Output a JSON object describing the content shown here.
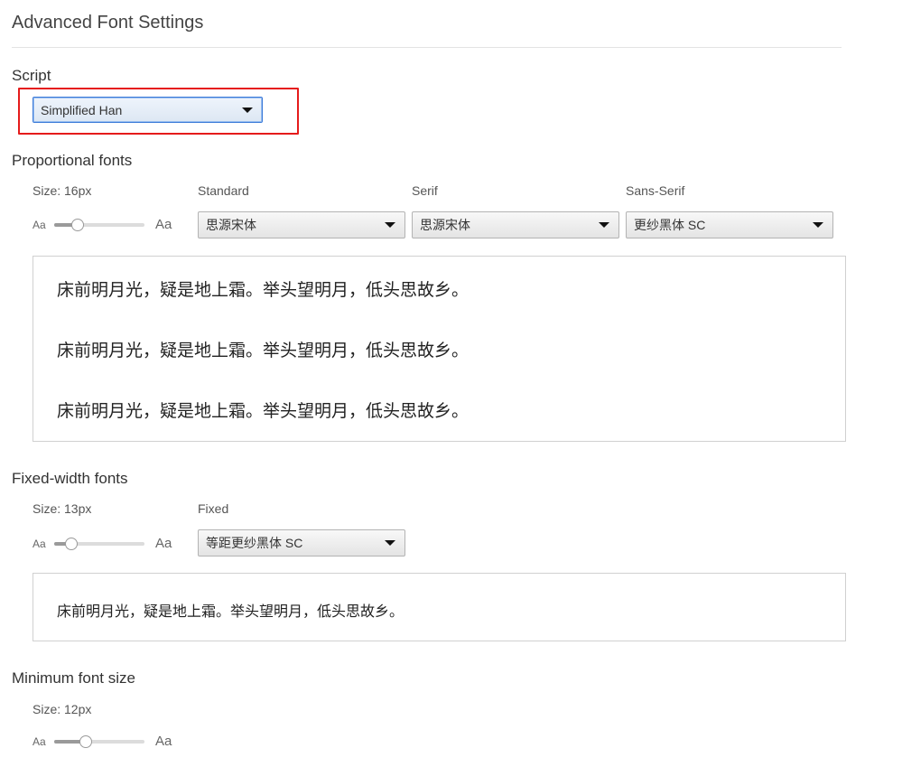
{
  "page": {
    "title": "Advanced Font Settings"
  },
  "script_section": {
    "label": "Script",
    "selected": "Simplified Han"
  },
  "proportional": {
    "heading": "Proportional fonts",
    "size_label": "Size: 16px",
    "slider": {
      "min_label": "Aa",
      "max_label": "Aa",
      "level": 0.26
    },
    "standard": {
      "label": "Standard",
      "selected": "思源宋体"
    },
    "serif": {
      "label": "Serif",
      "selected": "思源宋体"
    },
    "sans_serif": {
      "label": "Sans-Serif",
      "selected": "更纱黑体 SC"
    },
    "samples": [
      "床前明月光，疑是地上霜。举头望明月，低头思故乡。",
      "床前明月光，疑是地上霜。举头望明月，低头思故乡。",
      "床前明月光，疑是地上霜。举头望明月，低头思故乡。"
    ]
  },
  "fixed_width": {
    "heading": "Fixed-width fonts",
    "size_label": "Size: 13px",
    "slider": {
      "min_label": "Aa",
      "max_label": "Aa",
      "level": 0.19
    },
    "fixed": {
      "label": "Fixed",
      "selected": "等距更纱黑体 SC"
    },
    "sample": "床前明月光，疑是地上霜。举头望明月，低头思故乡。"
  },
  "minimum": {
    "heading": "Minimum font size",
    "size_label": "Size: 12px",
    "slider": {
      "min_label": "Aa",
      "max_label": "Aa",
      "level": 0.36
    }
  },
  "colors": {
    "highlight": "#e51b1b",
    "focus": "#3a79d8"
  },
  "icons": {
    "dropdown": "triangle-down"
  }
}
